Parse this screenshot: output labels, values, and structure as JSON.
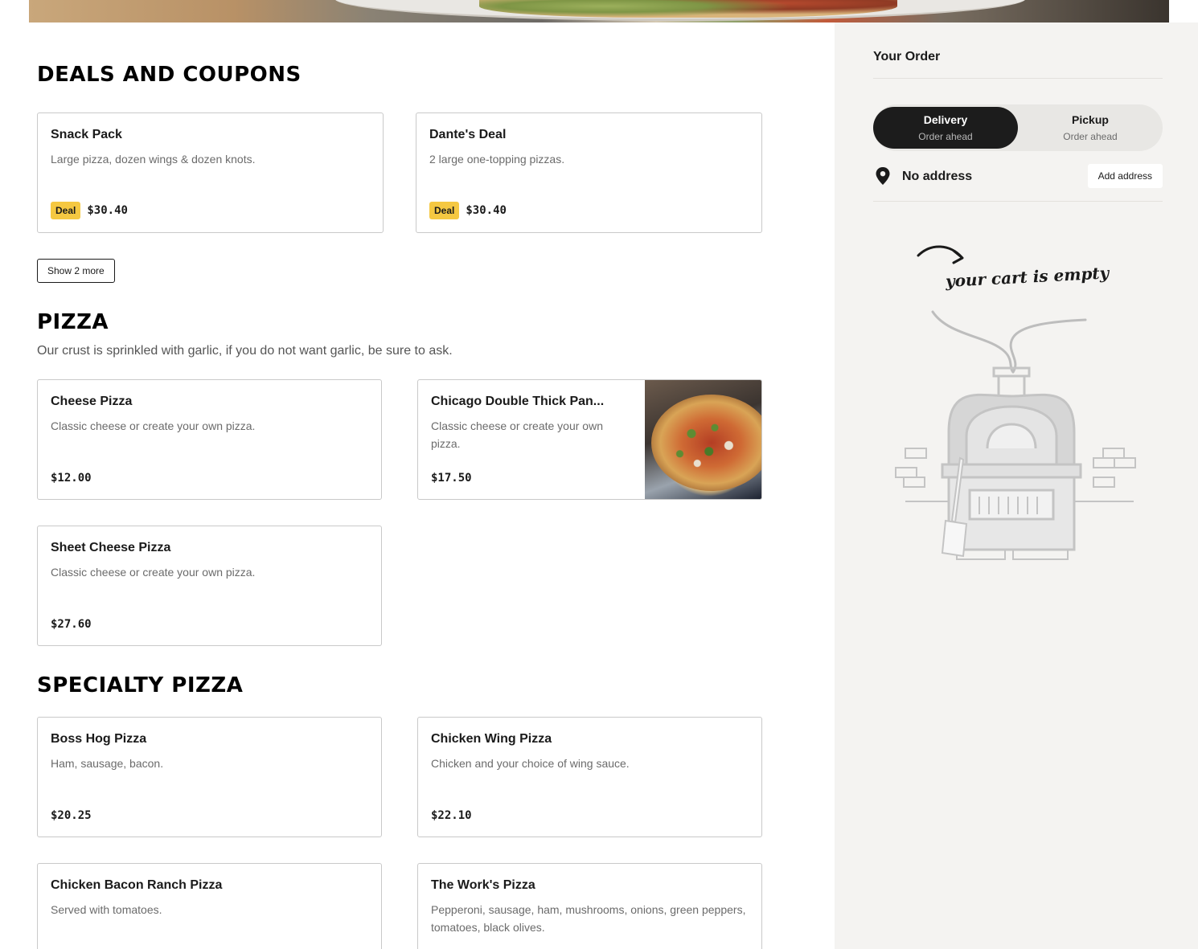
{
  "sections": {
    "deals": {
      "title": "DEALS AND COUPONS",
      "items": [
        {
          "name": "Snack Pack",
          "desc": "Large pizza, dozen wings & dozen knots.",
          "badge": "Deal",
          "price": "$30.40"
        },
        {
          "name": "Dante's Deal",
          "desc": "2 large one-topping pizzas.",
          "badge": "Deal",
          "price": "$30.40"
        }
      ],
      "more_label": "Show 2 more"
    },
    "pizza": {
      "title": "PIZZA",
      "subtitle": "Our crust is sprinkled with garlic, if you do not want garlic, be sure to ask.",
      "items": [
        {
          "name": "Cheese Pizza",
          "desc": "Classic cheese or create your own pizza.",
          "price": "$12.00"
        },
        {
          "name": "Chicago Double Thick Pan...",
          "desc": "Classic cheese or create your own pizza.",
          "price": "$17.50"
        },
        {
          "name": "Sheet Cheese Pizza",
          "desc": "Classic cheese or create your own pizza.",
          "price": "$27.60"
        }
      ]
    },
    "specialty": {
      "title": "SPECIALTY PIZZA",
      "items": [
        {
          "name": "Boss Hog Pizza",
          "desc": "Ham, sausage, bacon.",
          "price": "$20.25"
        },
        {
          "name": "Chicken Wing Pizza",
          "desc": "Chicken and your choice of wing sauce.",
          "price": "$22.10"
        },
        {
          "name": "Chicken Bacon Ranch Pizza",
          "desc": "Served with tomatoes."
        },
        {
          "name": "The Work's Pizza",
          "desc": "Pepperoni, sausage, ham, mushrooms, onions, green peppers, tomatoes, black olives."
        }
      ]
    }
  },
  "order": {
    "title": "Your Order",
    "delivery": {
      "label": "Delivery",
      "sub": "Order ahead"
    },
    "pickup": {
      "label": "Pickup",
      "sub": "Order ahead"
    },
    "address_text": "No address",
    "add_address_label": "Add address",
    "empty_text": "your cart is empty"
  },
  "colors": {
    "accent_dark": "#1c1c1c",
    "deal_badge": "#f5c842",
    "sidebar_bg": "#f4f3f1"
  },
  "icons": {
    "location": "map-pin-icon",
    "arrow": "curved-arrow-icon",
    "oven": "pizza-oven-illustration"
  }
}
